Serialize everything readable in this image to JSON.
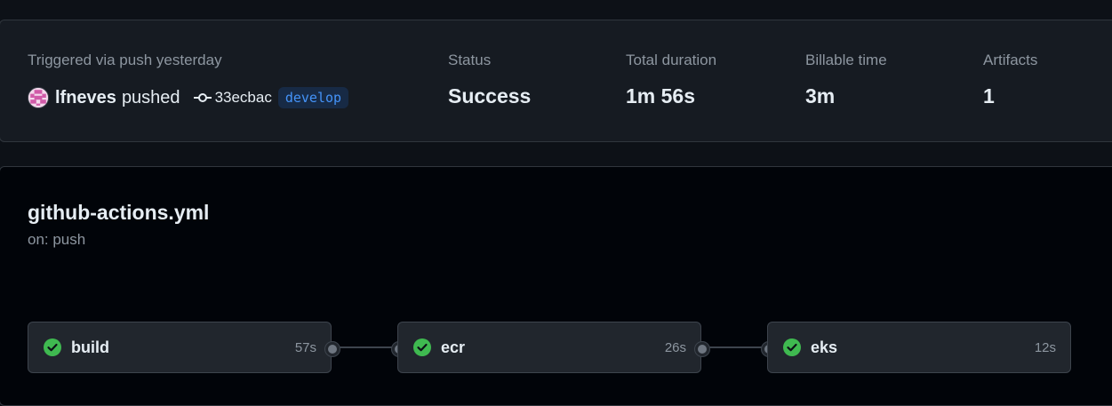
{
  "summary": {
    "triggered_text": "Triggered via push yesterday",
    "username": "lfneves",
    "action": "pushed",
    "commit_sha": "33ecbac",
    "branch": "develop",
    "stats": {
      "status": {
        "label": "Status",
        "value": "Success"
      },
      "total_duration": {
        "label": "Total duration",
        "value": "1m 56s"
      },
      "billable_time": {
        "label": "Billable time",
        "value": "3m"
      },
      "artifacts": {
        "label": "Artifacts",
        "value": "1"
      }
    }
  },
  "workflow": {
    "file": "github-actions.yml",
    "trigger": "on: push",
    "jobs": [
      {
        "name": "build",
        "duration": "57s",
        "status": "success"
      },
      {
        "name": "ecr",
        "duration": "26s",
        "status": "success"
      },
      {
        "name": "eks",
        "duration": "12s",
        "status": "success"
      }
    ]
  },
  "colors": {
    "success": "#3fb950",
    "branch_text": "#4493f8",
    "muted": "#8d96a0"
  },
  "icons": {
    "avatar": "identicon-avatar",
    "commit": "git-commit-icon",
    "job_status": "check-circle-fill-icon"
  }
}
